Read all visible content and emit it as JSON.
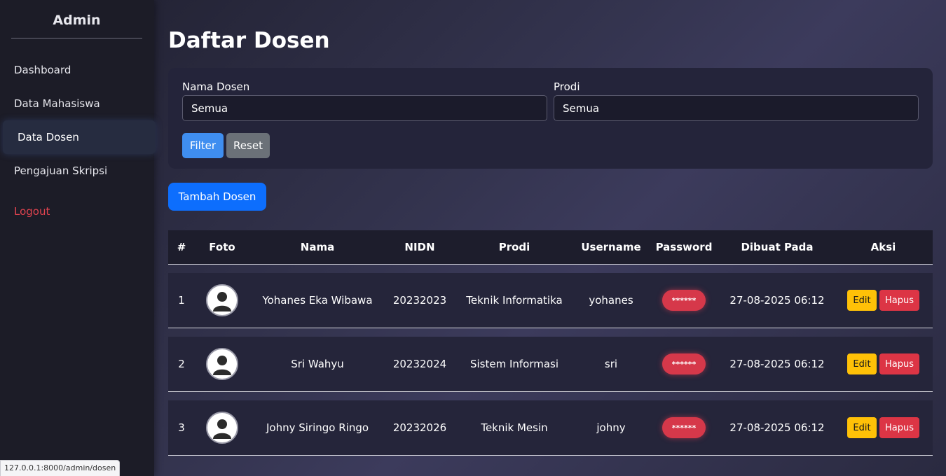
{
  "sidebar": {
    "brand": "Admin",
    "items": [
      {
        "label": "Dashboard"
      },
      {
        "label": "Data Mahasiswa"
      },
      {
        "label": "Data Dosen"
      },
      {
        "label": "Pengajuan Skripsi"
      }
    ],
    "logout": "Logout"
  },
  "page": {
    "title": "Daftar Dosen"
  },
  "filter": {
    "nama_label": "Nama Dosen",
    "nama_value": "Semua",
    "prodi_label": "Prodi",
    "prodi_value": "Semua",
    "filter_button": "Filter",
    "reset_button": "Reset"
  },
  "add_button": "Tambah Dosen",
  "table": {
    "headers": [
      "#",
      "Foto",
      "Nama",
      "NIDN",
      "Prodi",
      "Username",
      "Password",
      "Dibuat Pada",
      "Aksi"
    ],
    "rows": [
      {
        "no": "1",
        "nama": "Yohanes Eka Wibawa",
        "nidn": "20232023",
        "prodi": "Teknik Informatika",
        "username": "yohanes",
        "password": "******",
        "dibuat": "27-08-2025 06:12",
        "edit": "Edit",
        "hapus": "Hapus"
      },
      {
        "no": "2",
        "nama": "Sri Wahyu",
        "nidn": "20232024",
        "prodi": "Sistem Informasi",
        "username": "sri",
        "password": "******",
        "dibuat": "27-08-2025 06:12",
        "edit": "Edit",
        "hapus": "Hapus"
      },
      {
        "no": "3",
        "nama": "Johny Siringo Ringo",
        "nidn": "20232026",
        "prodi": "Teknik Mesin",
        "username": "johny",
        "password": "******",
        "dibuat": "27-08-2025 06:12",
        "edit": "Edit",
        "hapus": "Hapus"
      }
    ]
  },
  "status_bar": {
    "url": "127.0.0.1:8000/admin/dosen"
  },
  "colors": {
    "primary": "#0d6efd",
    "filter": "#3f8ef0",
    "reset": "#6b7178",
    "edit": "#ffc107",
    "delete": "#dc3545",
    "logout": "#e0434f"
  }
}
